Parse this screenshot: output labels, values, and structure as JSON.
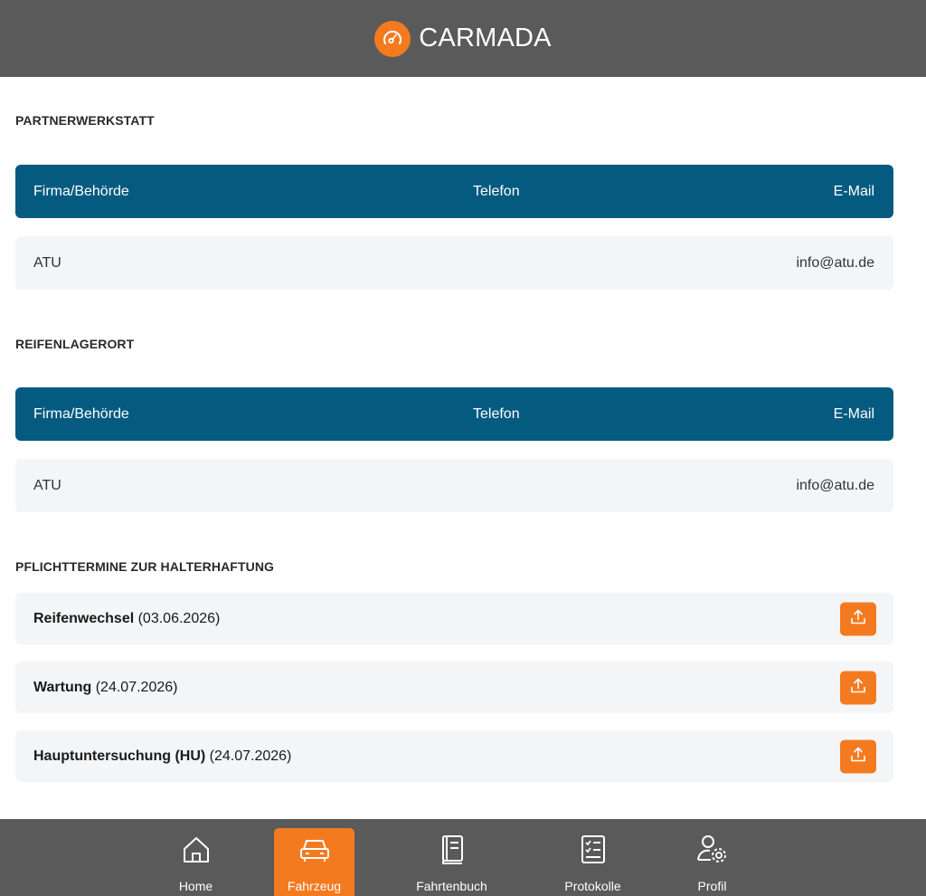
{
  "header": {
    "brand": "CARMADA",
    "logo_icon": "speedometer-icon",
    "accent": "#f47a20"
  },
  "colors": {
    "topbar": "#5a5a5a",
    "table_header": "#055a80",
    "row_bg": "#f4f5f7",
    "accent": "#f47a20"
  },
  "partner": {
    "title": "PARTNERWERKSTATT",
    "columns": [
      "Firma/Behörde",
      "Telefon",
      "E-Mail"
    ],
    "rows": [
      {
        "company": "ATU",
        "phone": "",
        "email": "info@atu.de"
      }
    ]
  },
  "tire_storage": {
    "title": "REIFENLAGERORT",
    "columns": [
      "Firma/Behörde",
      "Telefon",
      "E-Mail"
    ],
    "rows": [
      {
        "company": "ATU",
        "phone": "",
        "email": "info@atu.de"
      }
    ]
  },
  "duties": {
    "title": "PFLICHTTERMINE ZUR HALTERHAFTUNG",
    "items": [
      {
        "name": "Reifenwechsel",
        "date": " (03.06.2026)",
        "icon": "upload-icon"
      },
      {
        "name": "Wartung",
        "date": " (24.07.2026)",
        "icon": "upload-icon"
      },
      {
        "name": "Hauptuntersuchung (HU)",
        "date": " (24.07.2026)",
        "icon": "upload-icon"
      }
    ]
  },
  "nav": {
    "active": "Fahrzeug",
    "items": [
      {
        "label": "Home",
        "icon": "home-icon"
      },
      {
        "label": "Fahrzeug",
        "icon": "car-icon"
      },
      {
        "label": "Fahrtenbuch",
        "icon": "book-icon"
      },
      {
        "label": "Protokolle",
        "icon": "checklist-icon"
      },
      {
        "label": "Profil",
        "icon": "user-settings-icon"
      }
    ]
  }
}
